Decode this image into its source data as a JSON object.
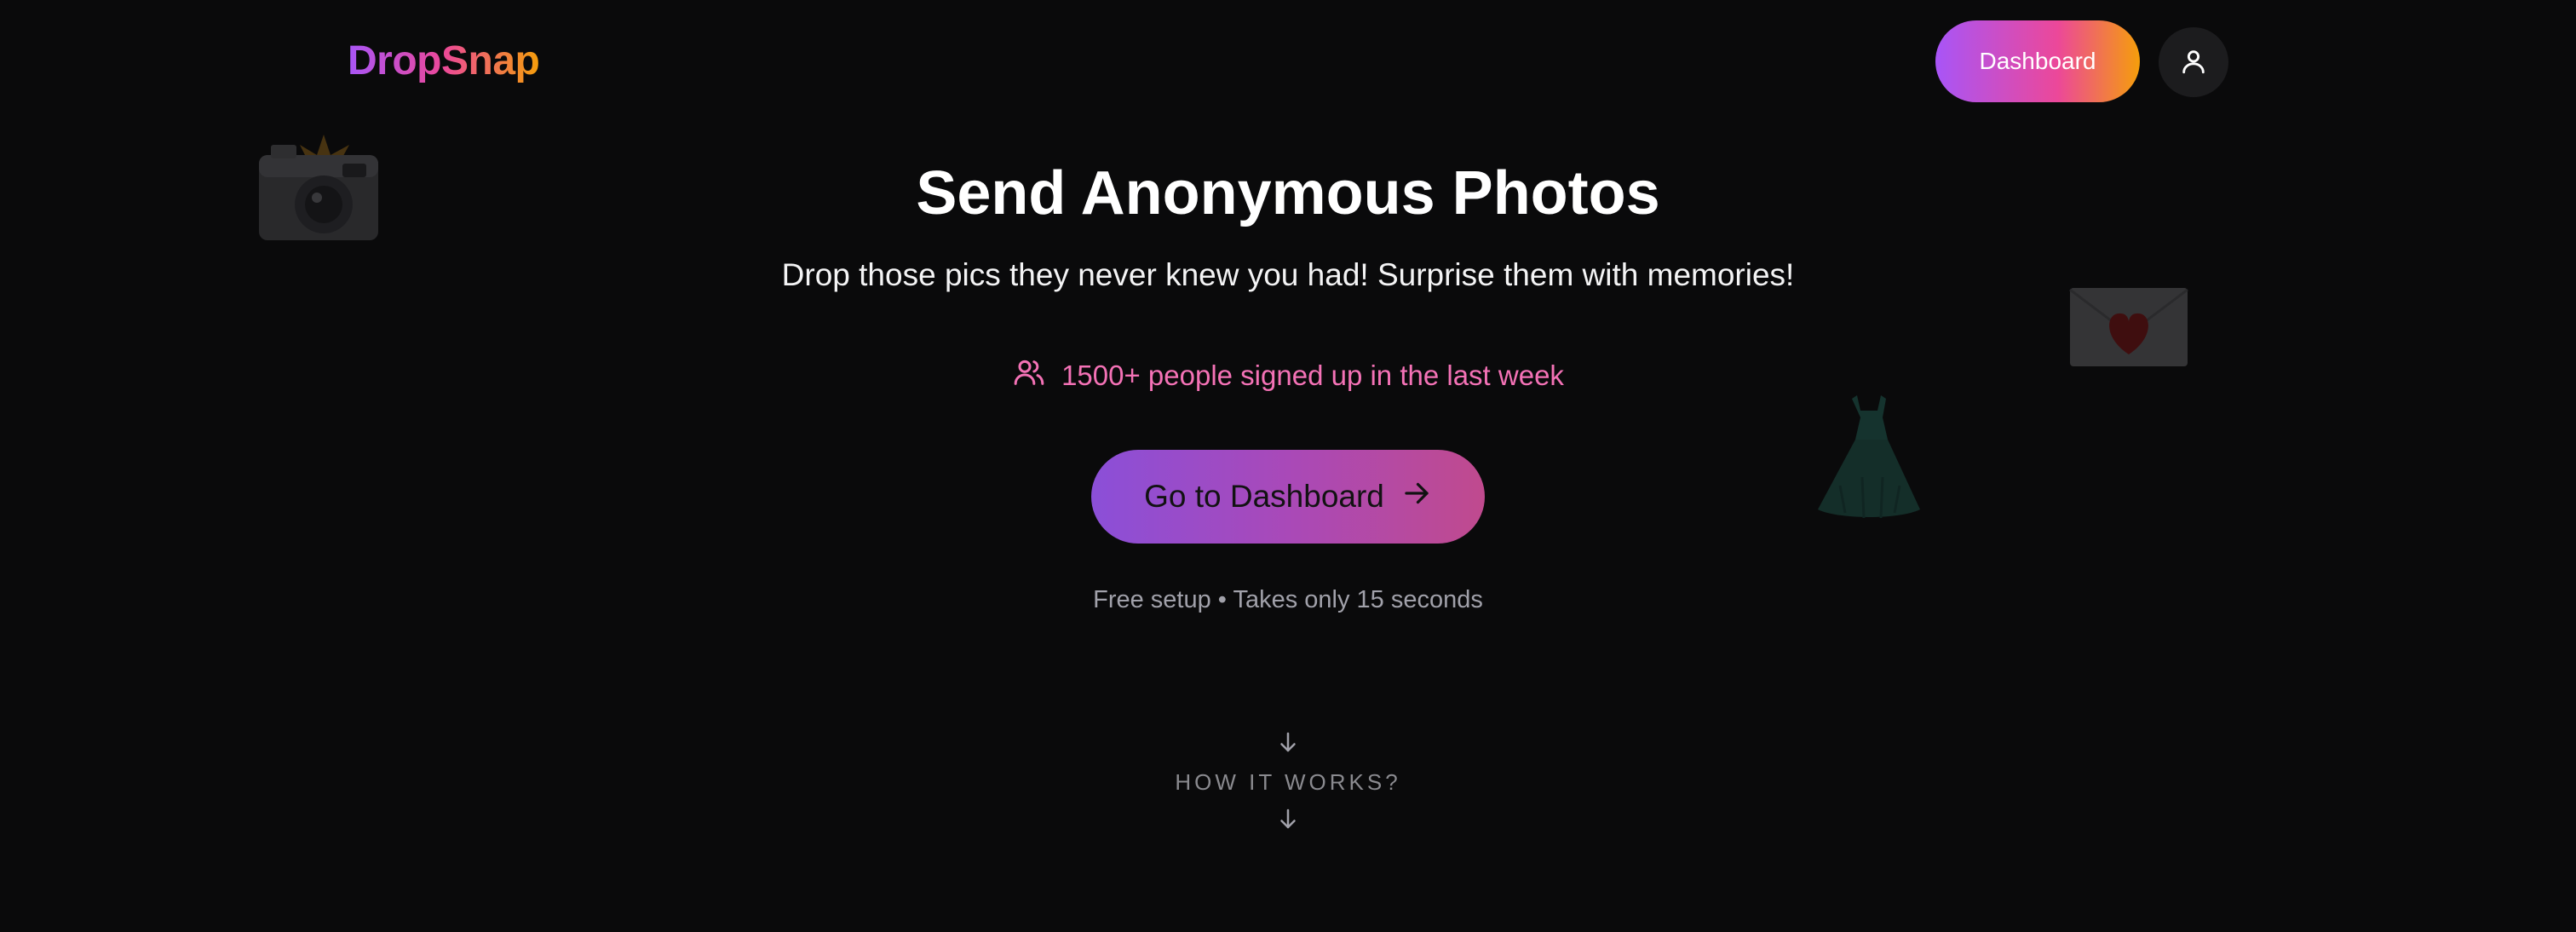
{
  "header": {
    "logo": "DropSnap",
    "dashboard_label": "Dashboard",
    "profile_icon": "user-icon"
  },
  "hero": {
    "title": "Send Anonymous Photos",
    "subtitle": "Drop those pics they never knew you had! Surprise them with memories!",
    "signup_text": "1500+ people signed up in the last week",
    "signup_icon": "users-icon",
    "cta_label": "Go to Dashboard",
    "cta_icon": "arrow-right-icon",
    "note": "Free setup • Takes only 15 seconds"
  },
  "how_it_works": {
    "label": "HOW IT WORKS?",
    "icon": "arrow-down-icon"
  },
  "decorations": [
    {
      "name": "camera-flash-icon"
    },
    {
      "name": "love-letter-icon"
    },
    {
      "name": "dress-icon"
    }
  ],
  "colors": {
    "background": "#0a0a0b",
    "accent_purple": "#a855f7",
    "accent_pink": "#ec4899",
    "accent_orange": "#f59e0b",
    "signup_text": "#f472b6"
  }
}
